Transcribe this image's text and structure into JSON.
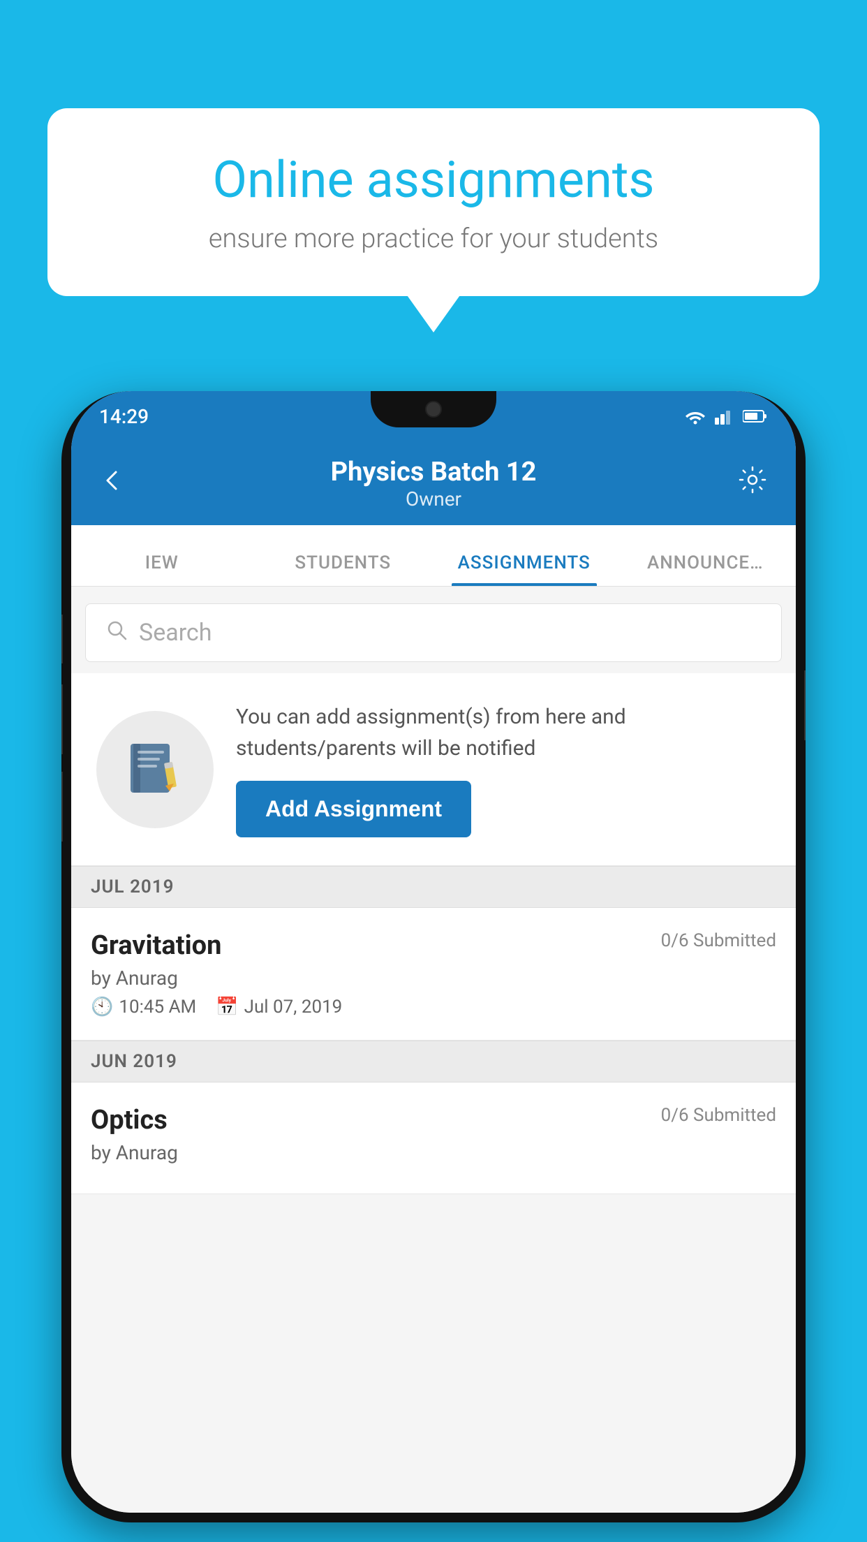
{
  "background_color": "#1ab8e8",
  "speech_bubble": {
    "title": "Online assignments",
    "subtitle": "ensure more practice for your students"
  },
  "phone": {
    "time": "14:29",
    "header": {
      "back_icon": "←",
      "title": "Physics Batch 12",
      "subtitle": "Owner",
      "settings_icon": "⚙"
    },
    "tabs": [
      {
        "label": "IEW",
        "active": false
      },
      {
        "label": "STUDENTS",
        "active": false
      },
      {
        "label": "ASSIGNMENTS",
        "active": true
      },
      {
        "label": "ANNOUNCE…",
        "active": false
      }
    ],
    "search": {
      "placeholder": "Search"
    },
    "promo": {
      "icon": "📓",
      "text": "You can add assignment(s) from here and students/parents will be notified",
      "button_label": "Add Assignment"
    },
    "sections": [
      {
        "month_label": "JUL 2019",
        "assignments": [
          {
            "title": "Gravitation",
            "submitted": "0/6 Submitted",
            "author": "by Anurag",
            "time": "10:45 AM",
            "date": "Jul 07, 2019"
          }
        ]
      },
      {
        "month_label": "JUN 2019",
        "assignments": [
          {
            "title": "Optics",
            "submitted": "0/6 Submitted",
            "author": "by Anurag",
            "time": "",
            "date": ""
          }
        ]
      }
    ]
  }
}
